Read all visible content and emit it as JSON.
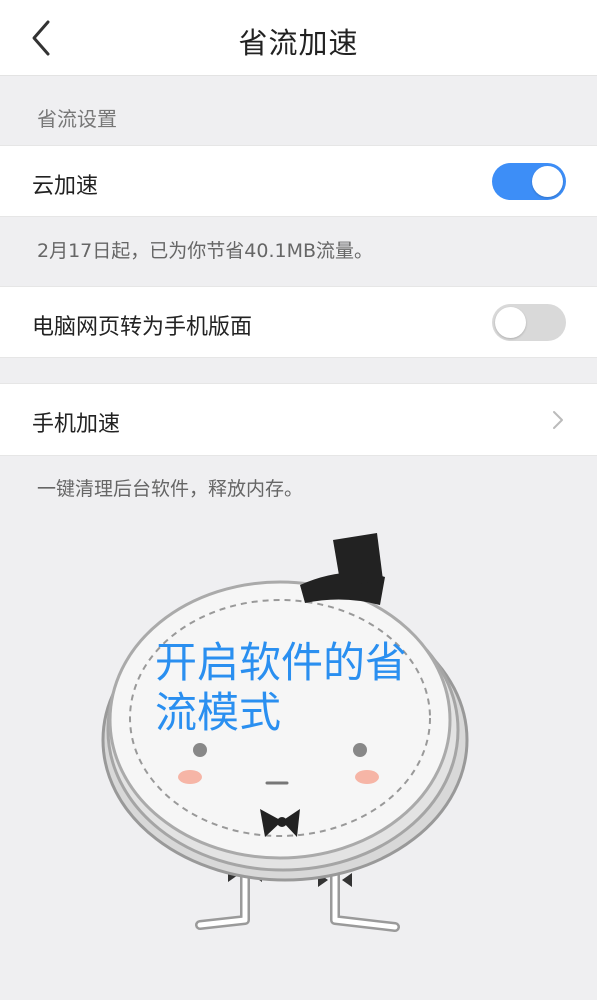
{
  "header": {
    "title": "省流加速",
    "back_icon": "chevron-left-icon"
  },
  "section": {
    "label": "省流设置"
  },
  "cloud_acceleration": {
    "label": "云加速",
    "toggle_on": true,
    "note": "2月17日起，已为你节省40.1MB流量。"
  },
  "pc_to_mobile": {
    "label": "电脑网页转为手机版面",
    "toggle_on": false
  },
  "phone_acceleration": {
    "label": "手机加速",
    "chevron_icon": "chevron-right-icon",
    "note": "一键清理后台软件，释放内存。"
  },
  "mascot": {
    "text": "开启软件的省流模式"
  },
  "colors": {
    "accent": "#3d8ef7",
    "mascot_text": "#2a8ff0",
    "background": "#efeff1"
  }
}
